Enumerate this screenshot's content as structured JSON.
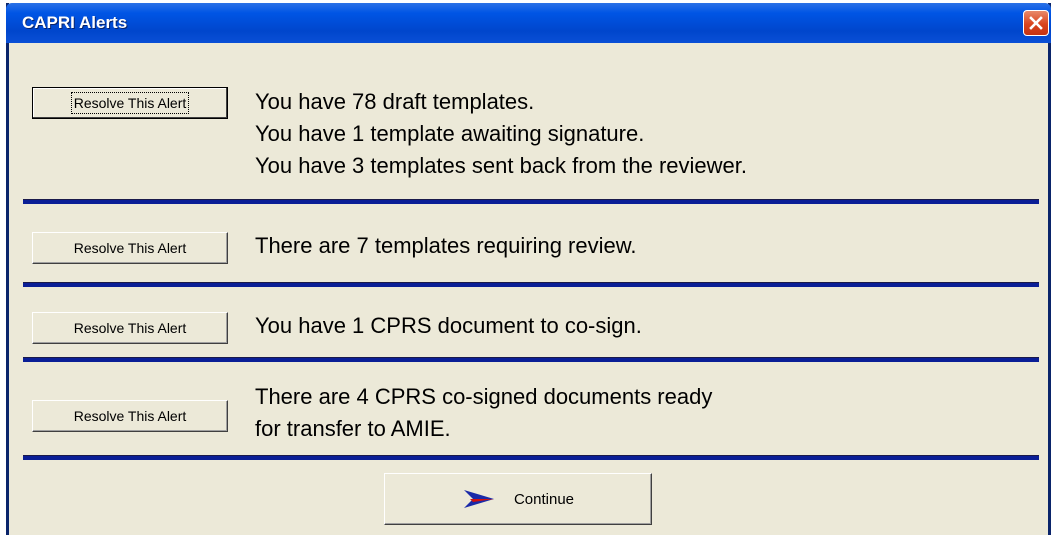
{
  "window": {
    "title": "CAPRI Alerts"
  },
  "alerts": [
    {
      "button_label": "Resolve This Alert",
      "lines": [
        "You have 78 draft templates.",
        "You have 1 template awaiting signature.",
        "You have 3 templates sent back from the reviewer."
      ]
    },
    {
      "button_label": "Resolve This Alert",
      "lines": [
        "There are 7 templates requiring review."
      ]
    },
    {
      "button_label": "Resolve This Alert",
      "lines": [
        "You have 1 CPRS document to co-sign."
      ]
    },
    {
      "button_label": "Resolve This Alert",
      "lines": [
        "There are 4 CPRS co-signed documents ready",
        "for transfer to AMIE."
      ]
    }
  ],
  "continue": {
    "label": "Continue",
    "icon": "arrow-right-icon"
  },
  "colors": {
    "separator": "#0a1e96",
    "titlebar": "#0055e5",
    "close": "#d9441e",
    "arrow_blue": "#1a2aa8",
    "arrow_red": "#d01010"
  }
}
